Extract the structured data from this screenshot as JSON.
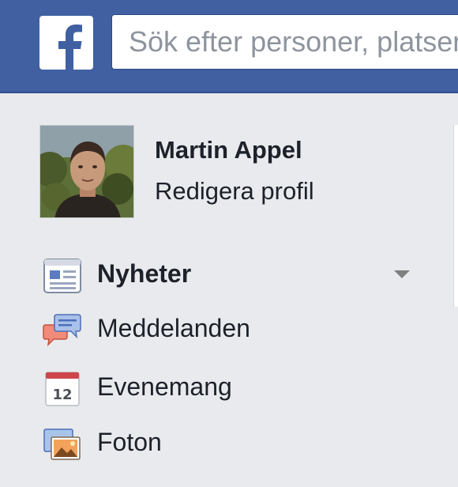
{
  "header": {
    "logo": "facebook-f-icon",
    "search": {
      "placeholder": "Sök efter personer, platser och saker",
      "value": ""
    },
    "brand_color": "#4060a2"
  },
  "profile": {
    "name": "Martin Appel",
    "edit_label": "Redigera profil"
  },
  "nav": {
    "items": [
      {
        "label": "Nyheter",
        "icon": "news-feed-icon",
        "active": true
      },
      {
        "label": "Meddelanden",
        "icon": "messages-icon",
        "active": false
      },
      {
        "label": "Evenemang",
        "icon": "calendar-icon",
        "icon_text": "12",
        "active": false
      },
      {
        "label": "Foton",
        "icon": "photos-icon",
        "active": false
      }
    ]
  }
}
